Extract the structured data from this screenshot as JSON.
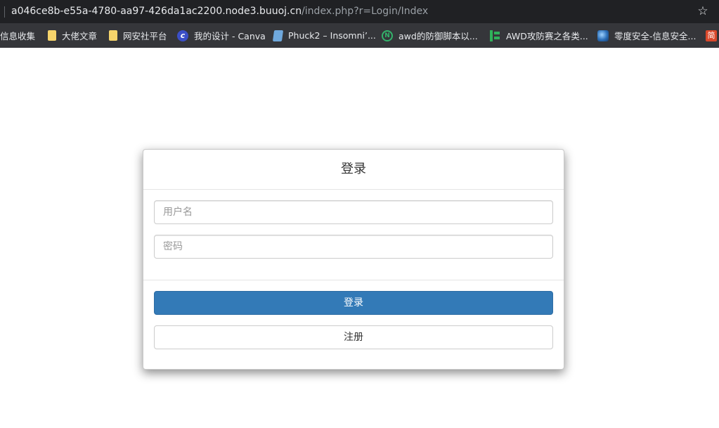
{
  "browser": {
    "url_host": "a046ce8b-e55a-4780-aa97-426da1ac2200.node3.buuoj.cn",
    "url_path": "/index.php?r=Login/Index",
    "bookmarks": [
      {
        "label": "信息收集",
        "icon": "none"
      },
      {
        "label": "大佬文章",
        "icon": "folder-icon"
      },
      {
        "label": "网安社平台",
        "icon": "folder-icon"
      },
      {
        "label": "我的设计 - Canva",
        "icon": "canva-icon"
      },
      {
        "label": "Phuck2 – Insomni’...",
        "icon": "doc-icon"
      },
      {
        "label": "awd的防御脚本以...",
        "icon": "n-icon"
      },
      {
        "label": "AWD攻防赛之各类...",
        "icon": "awd-icon"
      },
      {
        "label": "零度安全-信息安全...",
        "icon": "globe-icon"
      },
      {
        "label": "简",
        "icon": "cut-icon"
      }
    ]
  },
  "login": {
    "title": "登录",
    "username_placeholder": "用户名",
    "password_placeholder": "密码",
    "login_button": "登录",
    "register_button": "注册"
  },
  "colors": {
    "primary": "#337ab7",
    "toolbar": "#35363a",
    "addressbar": "#202124"
  }
}
